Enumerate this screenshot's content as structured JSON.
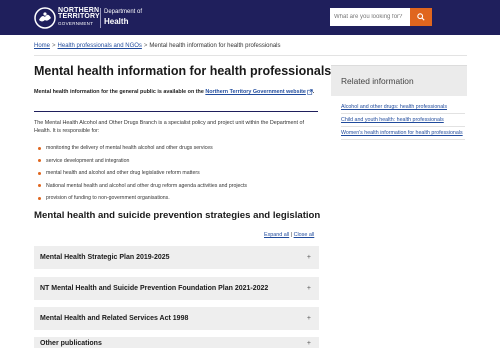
{
  "header": {
    "logo": {
      "line1": "NORTHERN",
      "line2": "TERRITORY",
      "line3": "GOVERNMENT"
    },
    "department_small": "Department of",
    "department_name": "Health",
    "search_placeholder": "What are you looking for?",
    "search_icon": "search-icon",
    "brand_color": "#1f1f5c",
    "accent_color": "#e0661e"
  },
  "breadcrumb": {
    "items": [
      "Home",
      "Health professionals and NGOs",
      "Mental health information for health professionals"
    ],
    "separator": ">"
  },
  "main": {
    "title": "Mental health information for health professionals",
    "intro_prefix": "Mental health information for the general public is available on the ",
    "intro_link": "Northern Territory Government website",
    "intro_suffix": ".",
    "body": "The Mental Health Alcohol and Other Drugs Branch is a specialist policy and project unit within the Department of Health. It is responsible for:",
    "bullets": [
      "monitoring the delivery of mental health alcohol and other drugs services",
      "service development and integration",
      "mental health and alcohol and other drug legislative reform matters",
      "National mental health and alcohol and other drug reform agenda activities and projects",
      "provision of funding to non-government organisations."
    ],
    "section_heading": "Mental health and suicide prevention strategies and legislation",
    "expand_all": "Expand all",
    "expand_sep": "|",
    "close_all": "Close all",
    "accordion": [
      {
        "label": "Mental Health Strategic Plan 2019-2025",
        "toggle": "+"
      },
      {
        "label": "NT Mental Health and Suicide Prevention Foundation Plan 2021-2022",
        "toggle": "+"
      },
      {
        "label": "Mental Health and Related Services Act 1998",
        "toggle": "+"
      },
      {
        "label": "Other publications",
        "toggle": "+"
      }
    ]
  },
  "sidebar": {
    "title": "Related information",
    "links": [
      "Alcohol and other drugs: health professionals",
      "Child and youth health: health professionals",
      "Women's health information for health professionals"
    ]
  }
}
